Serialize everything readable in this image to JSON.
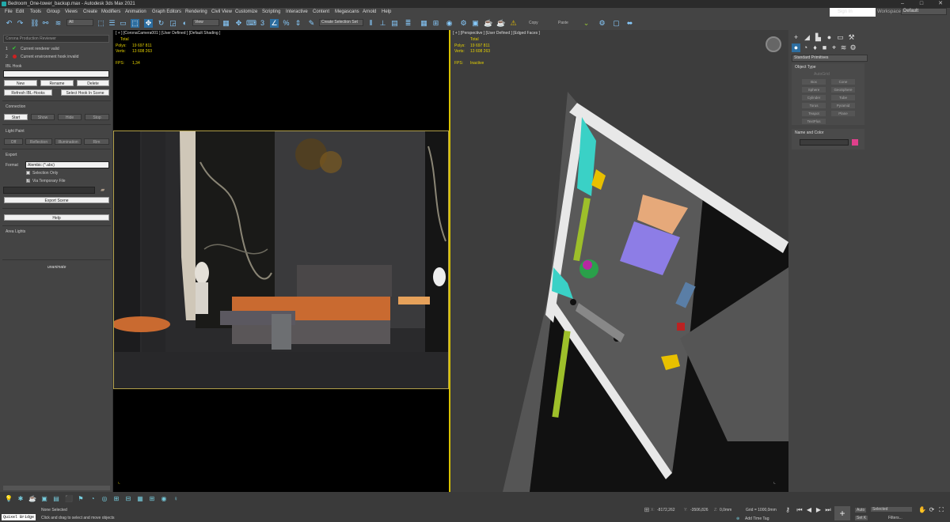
{
  "window": {
    "title": "Bedroom_One-tower_backup.max - Autodesk 3ds Max 2021"
  },
  "menu": [
    "File",
    "Edit",
    "Tools",
    "Group",
    "Views",
    "Create",
    "Modifiers",
    "Animation",
    "Graph Editors",
    "Rendering",
    "Civil View",
    "Customize",
    "Scripting",
    "Interactive",
    "Content",
    "Megascans",
    "Arnold",
    "Help"
  ],
  "toolbar": {
    "filter": "All",
    "ref_coord": "View",
    "selection_set": "Create Selection Set",
    "copy": "Copy",
    "paste": "Paste"
  },
  "account": {
    "sign_in": "Sign In",
    "workspace_label": "Workspaces:",
    "workspace": "Default"
  },
  "left_panel": {
    "header": "Corona Production Reviewer",
    "checks": [
      {
        "num": "1",
        "status": "ok",
        "text": "Current renderer valid"
      },
      {
        "num": "2",
        "status": "error",
        "text": "Current environment hook invalid"
      }
    ],
    "ibl_hook": {
      "title": "IBL Hook",
      "new": "New",
      "rename": "Rename",
      "delete": "Delete",
      "refresh": "Refresh IBL-Hooks",
      "select": "Select Hook In Scene"
    },
    "connection": {
      "title": "Connection",
      "start": "Start",
      "show": "Show",
      "hide": "Hide",
      "stop": "Stop"
    },
    "light_paint": {
      "title": "Light Paint",
      "off": "Off",
      "reflection": "Reflection",
      "illumination": "Illumination",
      "rim": "Rim"
    },
    "export": {
      "title": "Export",
      "format_label": "Format",
      "format_value": "Alembic (*.abc)",
      "selection_only": "Selection Only",
      "temp_file": "Via Temporary File",
      "export_scene": "Export Scene"
    },
    "help": "Help",
    "area_lights": "Area Lights",
    "logo_text": "unanimate"
  },
  "viewport_left": {
    "label": "[ + ] [CoronaCamera001 ] [User Defined ] [Default Shading ]",
    "total": "Total",
    "polys_label": "Polys:",
    "polys": "19 697 811",
    "verts_label": "Verts:",
    "verts": "13 608 263",
    "fps_label": "FPS:",
    "fps": "1,34"
  },
  "viewport_right": {
    "label": "[ + ] [Perspective ] [User Defined ] [Edged Faces ]",
    "total": "Total",
    "polys_label": "Polys:",
    "polys": "19 697 811",
    "verts_label": "Verts:",
    "verts": "13 608 263",
    "fps_label": "FPS:",
    "fps": "Inactive"
  },
  "command_panel": {
    "dropdown": "Standard Primitives",
    "object_type": "Object Type",
    "autogrid": "AutoGrid",
    "buttons": [
      "Box",
      "Cone",
      "Sphere",
      "GeoSphere",
      "Cylinder",
      "Tube",
      "Torus",
      "Pyramid",
      "Teapot",
      "Plane",
      "TextPlus"
    ],
    "name_color": "Name and Color",
    "color": "#e0408c"
  },
  "status": {
    "selected": "None Selected",
    "prompt": "Click and drag to select and move objects",
    "script_tab": "Quixel Bridge",
    "x": "-8172,262",
    "y": "-3506,826",
    "z": "0,0mm",
    "grid": "Grid = 1000,0mm",
    "add_time_tag": "Add Time Tag",
    "auto": "Auto",
    "set_k": "Set K",
    "selected_dd": "Selected",
    "filters": "Filters..."
  }
}
